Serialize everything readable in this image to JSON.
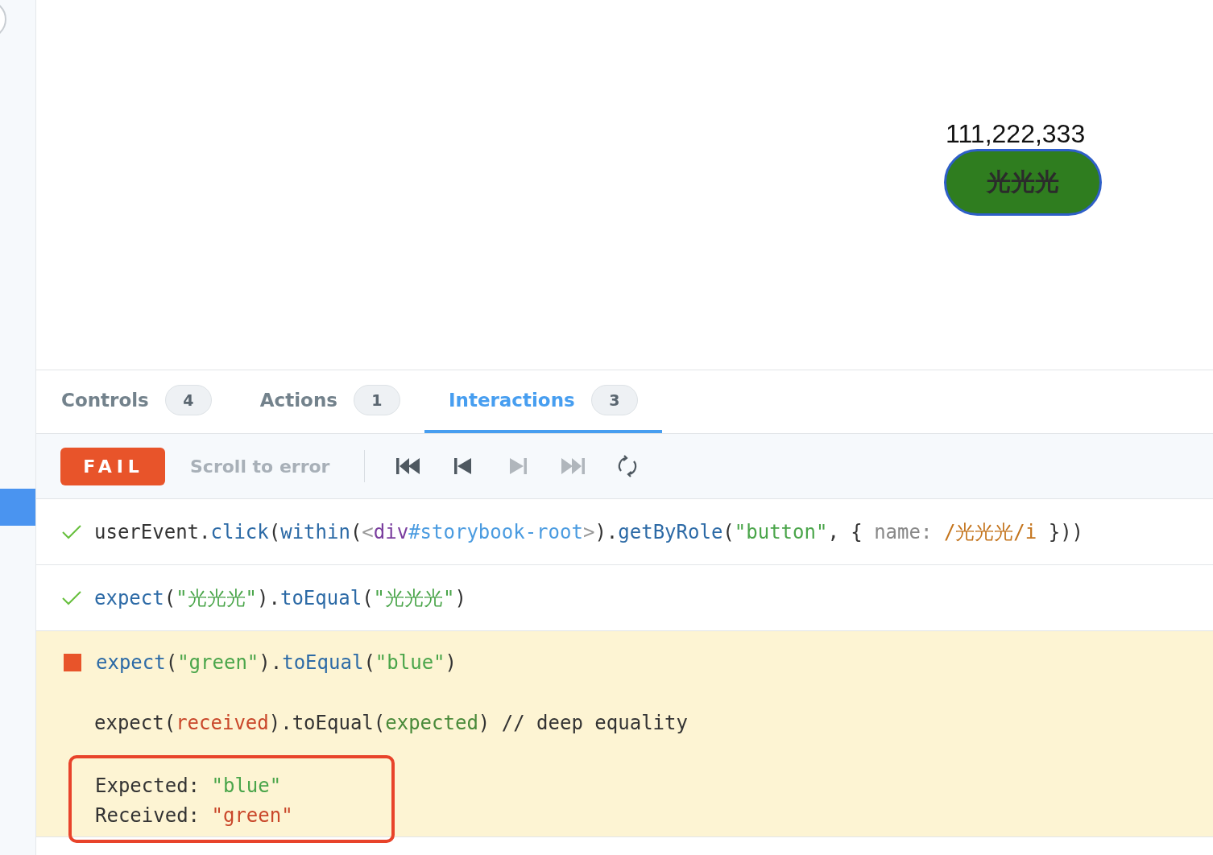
{
  "sidebar": {
    "items": [
      {
        "selected": true
      }
    ]
  },
  "preview": {
    "counter": "111,222,333",
    "button": {
      "label": "光光光"
    }
  },
  "tabs": [
    {
      "label": "Controls",
      "count": "4",
      "selected": false
    },
    {
      "label": "Actions",
      "count": "1",
      "selected": false
    },
    {
      "label": "Interactions",
      "count": "3",
      "selected": true
    }
  ],
  "toolbar": {
    "status": {
      "label": "FAIL",
      "kind": "fail"
    },
    "scroll_link": "Scroll to error",
    "controls": [
      {
        "kind": "first",
        "disabled": false
      },
      {
        "kind": "back",
        "disabled": false
      },
      {
        "kind": "next",
        "disabled": true
      },
      {
        "kind": "last",
        "disabled": true
      },
      {
        "kind": "rerun",
        "disabled": false
      }
    ]
  },
  "steps": [
    {
      "kind": "pass",
      "tokens": [
        {
          "text": "userEvent.",
          "kind": "plain"
        },
        {
          "text": "click",
          "kind": "fn"
        },
        {
          "text": "(",
          "kind": "plain"
        },
        {
          "text": "within",
          "kind": "fn"
        },
        {
          "text": "(",
          "kind": "plain"
        },
        {
          "text": "<",
          "kind": "angle"
        },
        {
          "text": "div",
          "kind": "tag"
        },
        {
          "text": "#storybook-root",
          "kind": "selector"
        },
        {
          "text": ">",
          "kind": "angle"
        },
        {
          "text": ").",
          "kind": "plain"
        },
        {
          "text": "getByRole",
          "kind": "fn"
        },
        {
          "text": "(",
          "kind": "plain"
        },
        {
          "text": "\"button\"",
          "kind": "string"
        },
        {
          "text": ", { ",
          "kind": "plain"
        },
        {
          "text": "name: ",
          "kind": "key"
        },
        {
          "text": "/光光光/i",
          "kind": "regex"
        },
        {
          "text": " }))",
          "kind": "plain"
        }
      ]
    },
    {
      "kind": "pass",
      "tokens": [
        {
          "text": "expect",
          "kind": "fn"
        },
        {
          "text": "(",
          "kind": "plain"
        },
        {
          "text": "\"光光光\"",
          "kind": "string"
        },
        {
          "text": ").",
          "kind": "plain"
        },
        {
          "text": "toEqual",
          "kind": "fn"
        },
        {
          "text": "(",
          "kind": "plain"
        },
        {
          "text": "\"光光光\"",
          "kind": "string"
        },
        {
          "text": ")",
          "kind": "plain"
        }
      ]
    },
    {
      "kind": "fail",
      "tokens": [
        {
          "text": "expect",
          "kind": "fn"
        },
        {
          "text": "(",
          "kind": "plain"
        },
        {
          "text": "\"green\"",
          "kind": "string"
        },
        {
          "text": ").",
          "kind": "plain"
        },
        {
          "text": "toEqual",
          "kind": "fn"
        },
        {
          "text": "(",
          "kind": "plain"
        },
        {
          "text": "\"blue\"",
          "kind": "string"
        },
        {
          "text": ")",
          "kind": "plain"
        }
      ],
      "message": [
        {
          "text": "expect(",
          "kind": "plain"
        },
        {
          "text": "received",
          "kind": "received"
        },
        {
          "text": ").toEqual(",
          "kind": "plain"
        },
        {
          "text": "expected",
          "kind": "expected"
        },
        {
          "text": ") // deep equality",
          "kind": "plain"
        }
      ],
      "diff_highlighted": true,
      "diff": [
        {
          "label": "Expected: ",
          "value": "\"blue\"",
          "kind": "expected"
        },
        {
          "label": "Received: ",
          "value": "\"green\"",
          "kind": "received"
        }
      ]
    }
  ]
}
